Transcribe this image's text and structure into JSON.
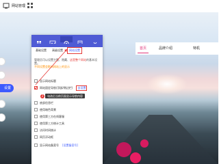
{
  "topbar": {
    "site_label": "网站管理"
  },
  "site_nav": {
    "tabs": [
      "首页",
      "品牌介绍",
      "特机"
    ],
    "active_index": 0
  },
  "side": {
    "settings_label": "设置"
  },
  "panel": {
    "tabs": [
      "基础设置",
      "高级设置",
      "网站设置"
    ],
    "highlighted_tab_index": 2,
    "description_lines": [
      {
        "text": "管理员可以设置主题、隐藏、",
        "color": "#555"
      },
      {
        "text": "这是整个网站",
        "color": "#e53935"
      },
      {
        "text": "的基本设置。",
        "color": "#555"
      }
    ],
    "notice": "不同设置会影响网站上的显示",
    "rows": [
      {
        "label": "显示网站标题",
        "checked": false
      },
      {
        "label": "网站固定导航(顶部/侧边栏)",
        "checked": true,
        "action": "去设置"
      },
      {
        "label": "底部信息栏",
        "checked": false
      },
      {
        "label": "使用暗色背景",
        "checked": false
      },
      {
        "label": "使用第三方在线客服",
        "checked": false
      },
      {
        "label": "使用第三方统计工具",
        "checked": false
      },
      {
        "label": "访问时间统计",
        "checked": false
      },
      {
        "label": "网页浮动框",
        "checked": false
      },
      {
        "label": "显示网站备案号",
        "checked": false,
        "link": "[设置备案号]"
      }
    ],
    "tooltip": "勾选后当前页面显示导航内容",
    "tooltip_badge": "2"
  },
  "colors": {
    "toolbar": "#4f5bd5",
    "accent": "#e0357a",
    "highlight": "#e53935",
    "link": "#3d5afe"
  },
  "icons": [
    "site-icon",
    "grid-icon",
    "grid-icon",
    "image-icon",
    "gear-icon",
    "template-icon",
    "chevron-down-icon",
    "chat-icon",
    "phone-icon",
    "message-icon",
    "qrcode-icon",
    "gear-icon"
  ]
}
